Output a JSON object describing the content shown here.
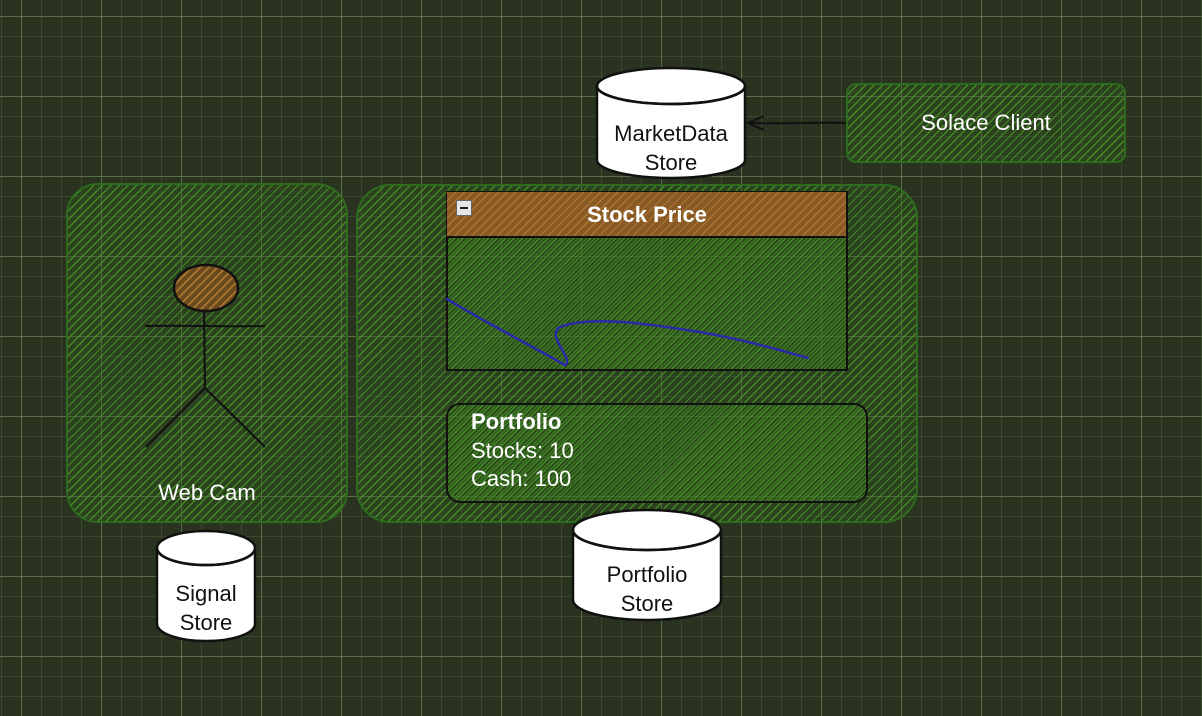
{
  "diagram": {
    "solace_client": "Solace Client",
    "market_data_store": [
      "MarketData",
      "Store"
    ],
    "web_cam": "Web Cam",
    "signal_store": [
      "Signal",
      "Store"
    ],
    "stock_price_title": "Stock Price",
    "portfolio": {
      "title": "Portfolio",
      "stocks": "Stocks: 10",
      "cash": "Cash: 100"
    },
    "portfolio_store": [
      "Portfolio",
      "Store"
    ]
  },
  "colors": {
    "background": "#2a3220",
    "hatch_fill": "#46962a",
    "title_bar": "#8a5a24",
    "price_line": "#2a2aa8",
    "cylinder": "#ffffff"
  }
}
